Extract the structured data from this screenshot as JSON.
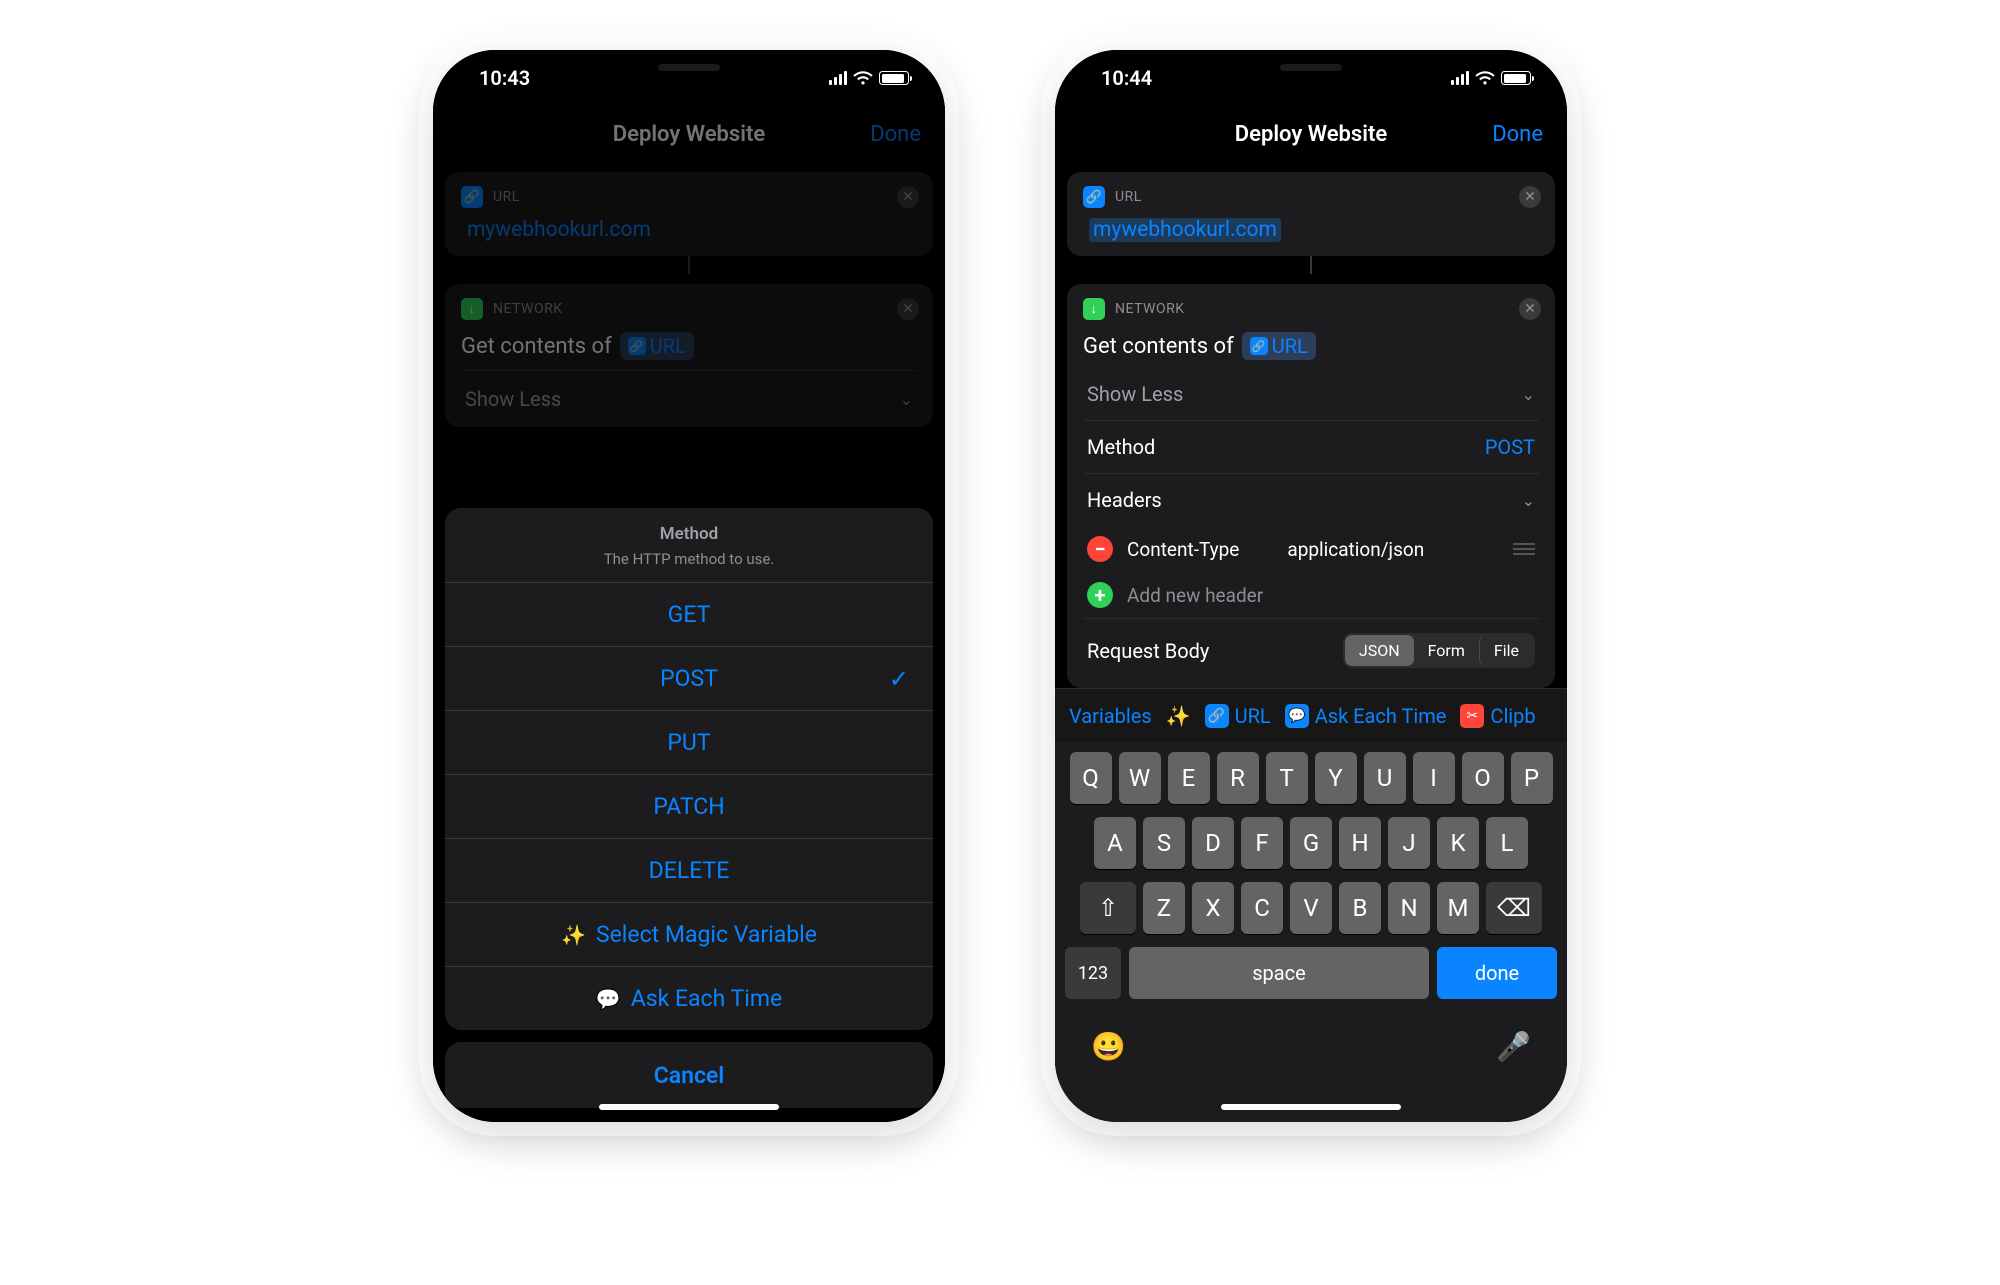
{
  "left": {
    "status_time": "10:43",
    "nav_title": "Deploy Website",
    "nav_done": "Done",
    "url_card": {
      "badge": "URL",
      "value": "mywebhookurl.com"
    },
    "net_card": {
      "badge": "NETWORK",
      "action_prefix": "Get contents of",
      "action_var": "URL",
      "show_less": "Show Less"
    },
    "sheet": {
      "title": "Method",
      "subtitle": "The HTTP method to use.",
      "options": [
        "GET",
        "POST",
        "PUT",
        "PATCH",
        "DELETE"
      ],
      "selected": "POST",
      "magic_variable": "Select Magic Variable",
      "ask_each_time": "Ask Each Time",
      "cancel": "Cancel"
    }
  },
  "right": {
    "status_time": "10:44",
    "nav_title": "Deploy Website",
    "nav_done": "Done",
    "url_card": {
      "badge": "URL",
      "value": "mywebhookurl.com"
    },
    "net_card": {
      "badge": "NETWORK",
      "action_prefix": "Get contents of",
      "action_var": "URL",
      "show_less": "Show Less",
      "method_label": "Method",
      "method_value": "POST",
      "headers_label": "Headers",
      "header_key": "Content-Type",
      "header_value": "application/json",
      "add_header": "Add new header",
      "body_label": "Request Body",
      "body_segments": [
        "JSON",
        "Form",
        "File"
      ],
      "body_selected": "JSON"
    },
    "suggest": {
      "variables": "Variables",
      "url": "URL",
      "ask": "Ask Each Time",
      "clip": "Clipb"
    },
    "keyboard": {
      "row1": [
        "Q",
        "W",
        "E",
        "R",
        "T",
        "Y",
        "U",
        "I",
        "O",
        "P"
      ],
      "row2": [
        "A",
        "S",
        "D",
        "F",
        "G",
        "H",
        "J",
        "K",
        "L"
      ],
      "row3": [
        "Z",
        "X",
        "C",
        "V",
        "B",
        "N",
        "M"
      ],
      "num": "123",
      "space": "space",
      "done": "done"
    }
  }
}
